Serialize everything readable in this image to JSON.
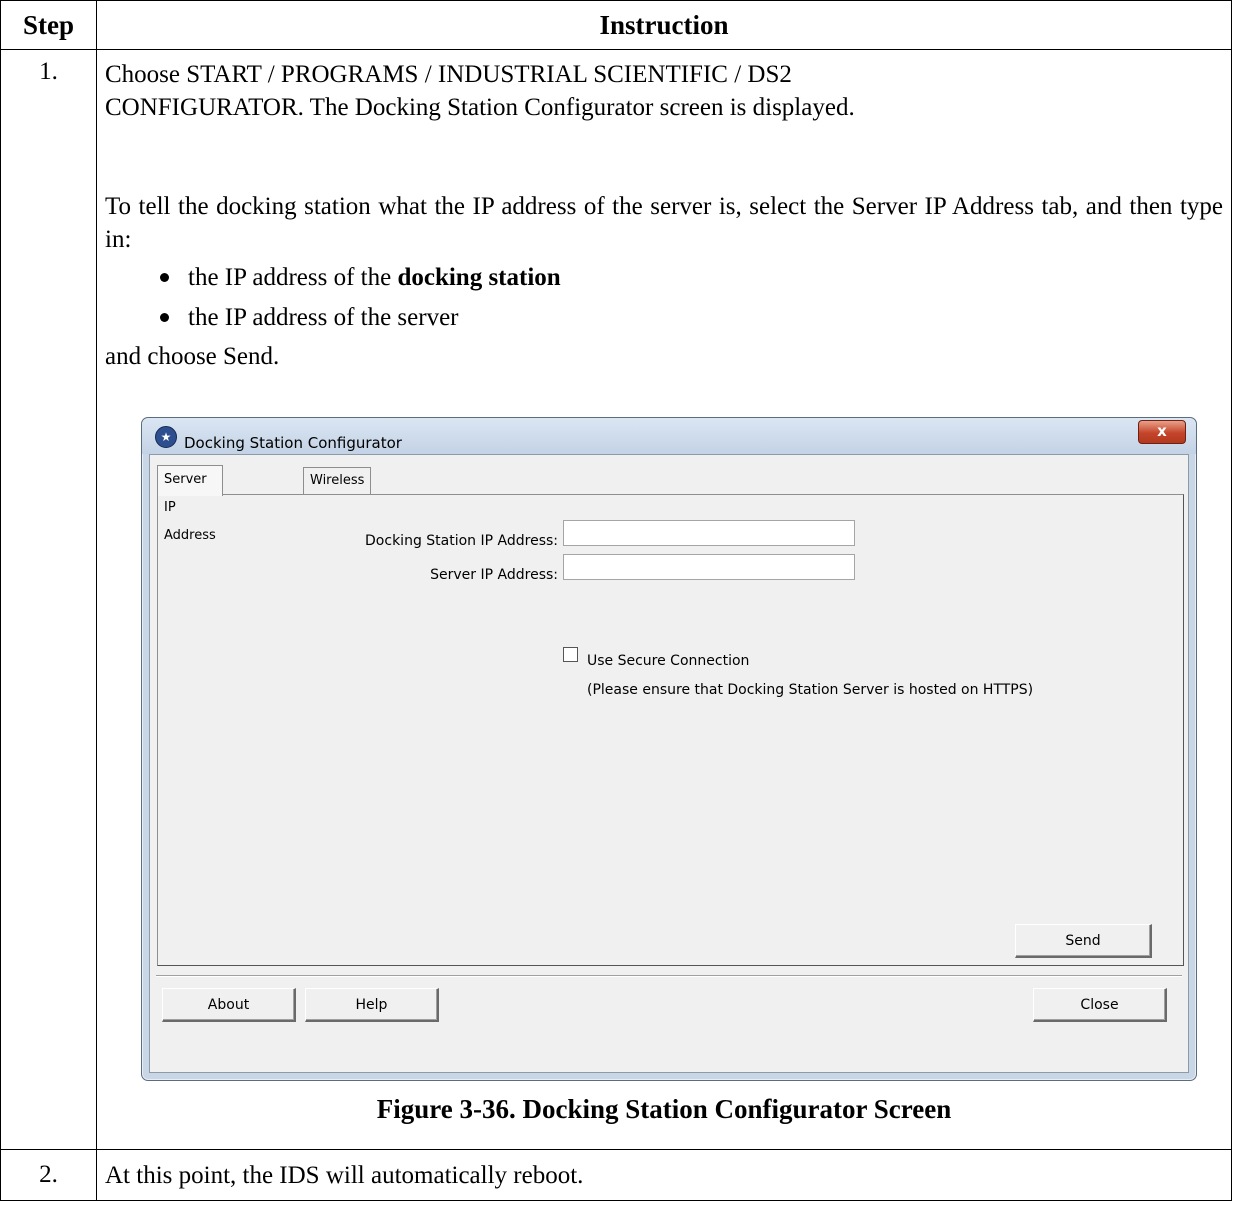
{
  "table": {
    "header_step": "Step",
    "header_instruction": "Instruction"
  },
  "step1": {
    "number": "1.",
    "line1": "Choose START / PROGRAMS / INDUSTRIAL SCIENTIFIC / DS2",
    "line2": "CONFIGURATOR.  The Docking Station Configurator screen is displayed.",
    "para2": "To tell the docking station what the IP address of the server is, select the Server IP Address tab, and then type in:",
    "bullet1_prefix": "the IP address of the ",
    "bullet1_bold": "docking station",
    "bullet2": "the IP address of the server",
    "closing": "and choose Send.",
    "caption": "Figure 3-36. Docking Station Configurator Screen"
  },
  "dialog": {
    "title": "Docking Station Configurator",
    "close_glyph": "x",
    "tabs": [
      "Server IP Address",
      "Wireless"
    ],
    "docking_ip_label": "Docking Station IP Address:",
    "docking_ip_value": "",
    "server_ip_label": "Server IP Address:",
    "server_ip_value": "",
    "secure_label": "Use Secure Connection",
    "secure_checked": false,
    "secure_note": "(Please ensure that Docking Station Server is hosted on HTTPS)",
    "send_label": "Send",
    "about_label": "About",
    "help_label": "Help",
    "close_label": "Close"
  },
  "step2": {
    "number": "2.",
    "text": "At this point, the IDS will automatically reboot."
  }
}
